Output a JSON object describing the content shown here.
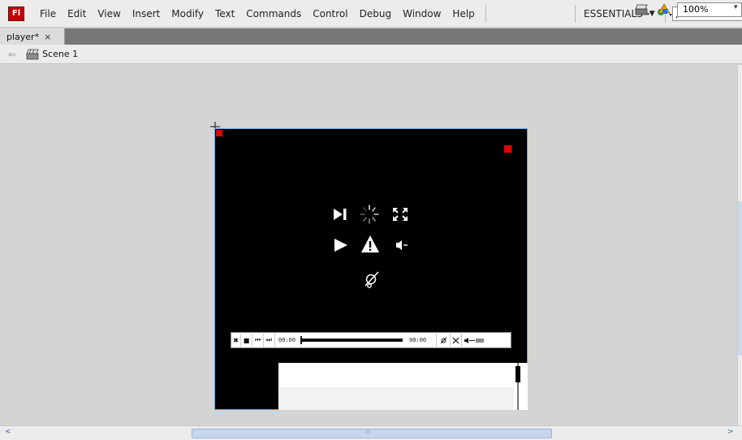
{
  "app": {
    "logo_text": "Fl",
    "menu": [
      "File",
      "Edit",
      "View",
      "Insert",
      "Modify",
      "Text",
      "Commands",
      "Control",
      "Debug",
      "Window",
      "Help"
    ],
    "workspace": "ESSENTIALS",
    "workspace_caret": "▼"
  },
  "document": {
    "tab_label": "player*",
    "tab_close": "×",
    "back_arrow": "⇐",
    "scene_label": "Scene 1",
    "zoom": "100%",
    "zoom_caret": "▾"
  },
  "player": {
    "time_current": "00:00",
    "time_total": "00:00"
  },
  "scroll": {
    "left": "<",
    "right": ">",
    "grip": "|||"
  },
  "colors": {
    "stage_bg": "#000000",
    "stage_border": "#5aa5e6",
    "registration": "#e00000"
  }
}
